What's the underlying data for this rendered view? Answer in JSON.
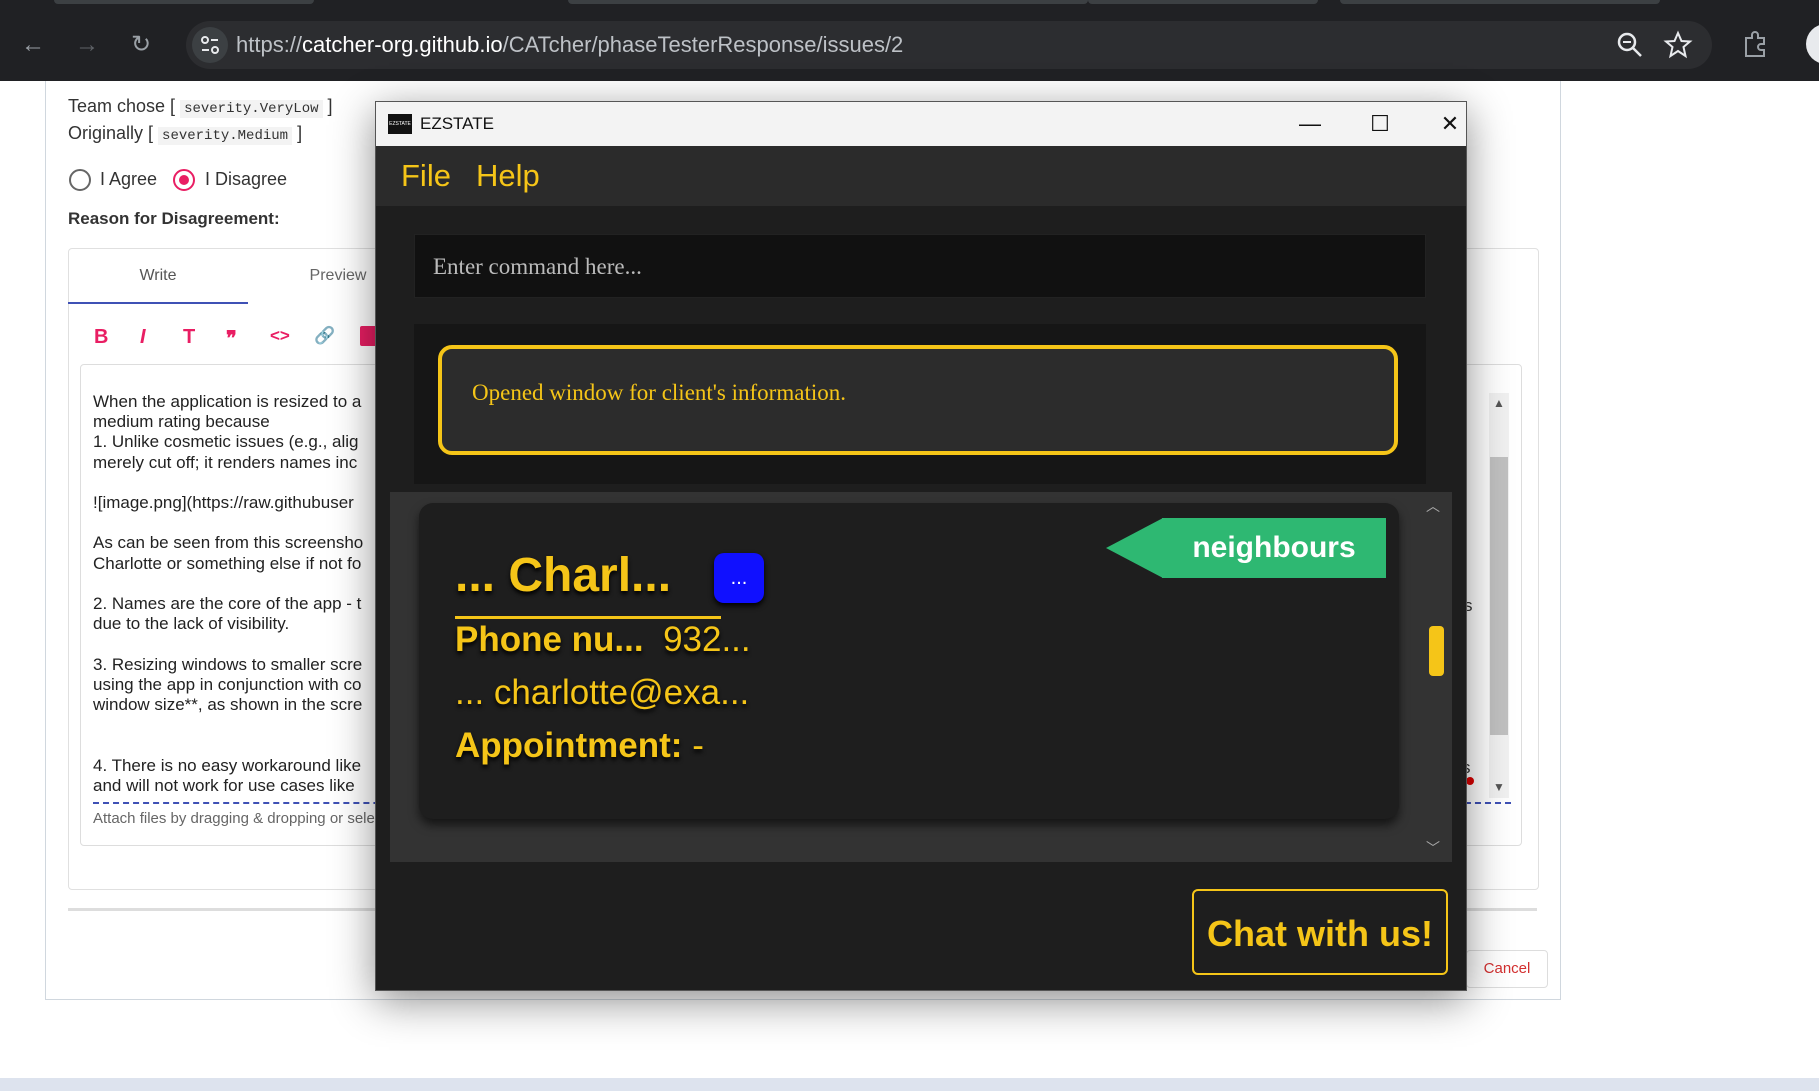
{
  "browser": {
    "url_scheme": "https://",
    "url_host": "catcher-org.github.io",
    "url_path": "/CATcher/phaseTesterResponse/issues/2",
    "back": "←",
    "forward": "→",
    "reload": "↻",
    "zoom_icon": "zoom-icon",
    "star_icon": "star-icon",
    "extensions_icon": "extensions-icon"
  },
  "page": {
    "team_chose_label": "Team chose [",
    "team_chose_value": "severity.VeryLow",
    "originally_label": "Originally [",
    "originally_value": "severity.Medium",
    "bracket_close": "]",
    "agree": "I Agree",
    "disagree": "I Disagree",
    "reason_label": "Reason for Disagreement:",
    "tab_write": "Write",
    "tab_preview": "Preview",
    "toolbar": [
      "B",
      "I",
      "T",
      "❞",
      "<>",
      "🔗"
    ],
    "editor_lines": [
      "When the application is resized to a",
      "medium rating because",
      "1.  Unlike cosmetic issues (e.g., alig",
      "merely cut off; it renders names inc",
      "",
      "![image.png](https://raw.githubuser",
      "",
      "As can be seen from this screensho",
      "Charlotte or something else if not fo",
      "",
      "2.  Names are the core of the app - t",
      "due to the lack of visibility.",
      "",
      "3. Resizing windows to smaller scre",
      "using the app in conjunction with co",
      "window size**, as shown in the scre",
      "",
      "",
      "4. There is no easy workaround like",
      "and will not work for use cases like"
    ],
    "attach_hint": "Attach files by dragging & dropping or selec",
    "right_edge_s1": "s",
    "right_edge_s2": "s",
    "cancel": "Cancel"
  },
  "app": {
    "title": "EZSTATE",
    "icon_text": "EZSTATE",
    "minimize": "—",
    "maximize": "☐",
    "close": "✕",
    "menu": [
      "File",
      "Help"
    ],
    "command_placeholder": "Enter command here...",
    "result_message": "Opened window for client's information.",
    "client": {
      "name": "... Charl...",
      "more_button": "...",
      "tag": "neighbours",
      "phone_label": "Phone nu...",
      "phone_value": "932...",
      "email": "... charlotte@exa...",
      "appointment_label": "Appointment:",
      "appointment_value": "-"
    },
    "chat_button": "Chat with us!",
    "accent_color": "#f5c518",
    "tag_color": "#2eb872"
  }
}
